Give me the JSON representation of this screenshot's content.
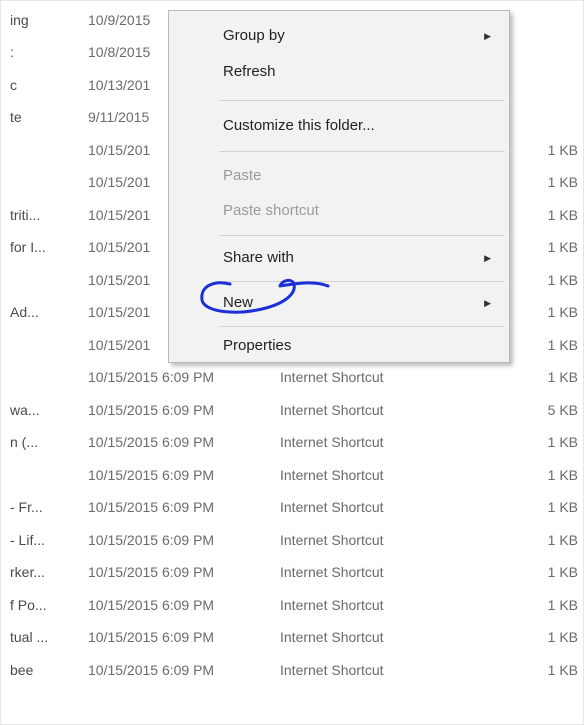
{
  "file_list": {
    "rows": [
      {
        "name": "ing",
        "date": "10/9/2015",
        "type": "",
        "size": ""
      },
      {
        "name": ":",
        "date": "10/8/2015",
        "type": "",
        "size": ""
      },
      {
        "name": "c",
        "date": "10/13/201",
        "type": "",
        "size": ""
      },
      {
        "name": "te",
        "date": "9/11/2015",
        "type": "",
        "size": ""
      },
      {
        "name": "",
        "date": "10/15/201",
        "type": "",
        "size": "1 KB"
      },
      {
        "name": "",
        "date": "10/15/201",
        "type": "",
        "size": "1 KB"
      },
      {
        "name": "triti...",
        "date": "10/15/201",
        "type": "",
        "size": "1 KB"
      },
      {
        "name": "for I...",
        "date": "10/15/201",
        "type": "",
        "size": "1 KB"
      },
      {
        "name": "",
        "date": "10/15/201",
        "type": "",
        "size": "1 KB"
      },
      {
        "name": "Ad...",
        "date": "10/15/201",
        "type": "",
        "size": "1 KB"
      },
      {
        "name": "",
        "date": "10/15/201",
        "type": "",
        "size": "1 KB"
      },
      {
        "name": "",
        "date": "10/15/2015 6:09 PM",
        "type": "Internet Shortcut",
        "size": "1 KB"
      },
      {
        "name": "wa...",
        "date": "10/15/2015 6:09 PM",
        "type": "Internet Shortcut",
        "size": "5 KB"
      },
      {
        "name": "n (...",
        "date": "10/15/2015 6:09 PM",
        "type": "Internet Shortcut",
        "size": "1 KB"
      },
      {
        "name": "",
        "date": "10/15/2015 6:09 PM",
        "type": "Internet Shortcut",
        "size": "1 KB"
      },
      {
        "name": "- Fr...",
        "date": "10/15/2015 6:09 PM",
        "type": "Internet Shortcut",
        "size": "1 KB"
      },
      {
        "name": "- Lif...",
        "date": "10/15/2015 6:09 PM",
        "type": "Internet Shortcut",
        "size": "1 KB"
      },
      {
        "name": "rker...",
        "date": "10/15/2015 6:09 PM",
        "type": "Internet Shortcut",
        "size": "1 KB"
      },
      {
        "name": "f Po...",
        "date": "10/15/2015 6:09 PM",
        "type": "Internet Shortcut",
        "size": "1 KB"
      },
      {
        "name": "tual ...",
        "date": "10/15/2015 6:09 PM",
        "type": "Internet Shortcut",
        "size": "1 KB"
      },
      {
        "name": "bee",
        "date": "10/15/2015 6:09 PM",
        "type": "Internet Shortcut",
        "size": "1 KB"
      }
    ]
  },
  "context_menu": {
    "group_by": "Group by",
    "refresh": "Refresh",
    "customize_folder": "Customize this folder...",
    "paste": "Paste",
    "paste_shortcut": "Paste shortcut",
    "share_with": "Share with",
    "new": "New",
    "properties": "Properties",
    "submenu_arrow_icon": "triangle-right"
  },
  "colors": {
    "menu_background": "#f2f2f2",
    "annotation_ink": "#1c2fd6",
    "disabled_text": "#9a9a9a"
  }
}
